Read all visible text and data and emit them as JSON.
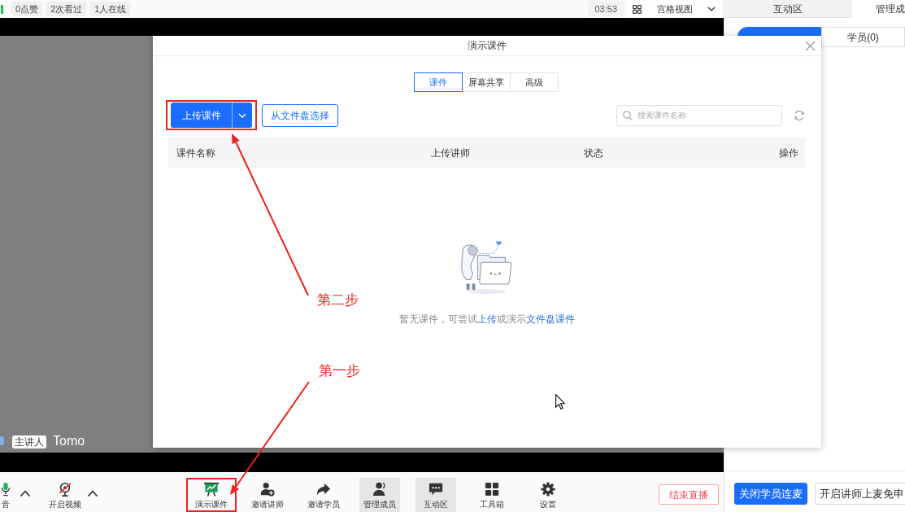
{
  "top_bar": {
    "stats": [
      "0点赞",
      "2次看过",
      "1人在线"
    ],
    "timer": "03:53",
    "view_selector": "宫格视图"
  },
  "right_panel": {
    "tabs": [
      {
        "label": "互动区",
        "selected": false
      },
      {
        "label": "管理成",
        "selected": true
      }
    ],
    "member_tabs": [
      {
        "selected": true
      },
      {
        "label": "学员(0)",
        "selected": false
      }
    ],
    "buttons": [
      {
        "label": "关闭学员连麦",
        "kind": "primary"
      },
      {
        "label": "开启讲师上麦免申",
        "kind": "outline"
      }
    ]
  },
  "dialog": {
    "title": "演示课件",
    "tabs": [
      {
        "label": "课件",
        "selected": true
      },
      {
        "label": "屏幕共享",
        "selected": false
      },
      {
        "label": "高级",
        "selected": false
      }
    ],
    "upload_button": {
      "label": "上传课件",
      "highlighted": true
    },
    "file_button": "从文件盘选择",
    "search": {
      "placeholder": "搜索课件名称"
    },
    "table": {
      "columns": [
        "课件名称",
        "上传讲师",
        "状态",
        "操作"
      ]
    },
    "empty_message": [
      {
        "kind": "text",
        "text": "暂无课件，可尝试"
      },
      {
        "kind": "link",
        "text": "上传"
      },
      {
        "kind": "text",
        "text": "或演示"
      },
      {
        "kind": "link",
        "text": "文件盘课件"
      }
    ]
  },
  "annotations": [
    {
      "label": "第二步"
    },
    {
      "label": "第一步"
    }
  ],
  "video": {
    "role_badge": "主讲人",
    "speaker": "Tomo"
  },
  "toolbar": {
    "left": [
      {
        "label": "音",
        "kind": "mic",
        "menu": true
      },
      {
        "label": "开启视频",
        "kind": "camera",
        "menu": true
      }
    ],
    "center": [
      {
        "label": "演示课件",
        "kind": "present",
        "selected": false,
        "highlighted": true
      },
      {
        "label": "邀请讲师",
        "kind": "invite",
        "selected": false,
        "highlighted": false
      },
      {
        "label": "邀请学员",
        "kind": "share",
        "selected": false,
        "highlighted": false
      },
      {
        "label": "管理成员",
        "kind": "members",
        "selected": true,
        "highlighted": false
      },
      {
        "label": "互动区",
        "kind": "chat",
        "selected": true,
        "highlighted": false
      },
      {
        "label": "工具箱",
        "kind": "tools",
        "selected": false,
        "highlighted": false
      },
      {
        "label": "设置",
        "kind": "settings",
        "selected": false,
        "highlighted": false
      }
    ],
    "end_button": "结束直播"
  }
}
